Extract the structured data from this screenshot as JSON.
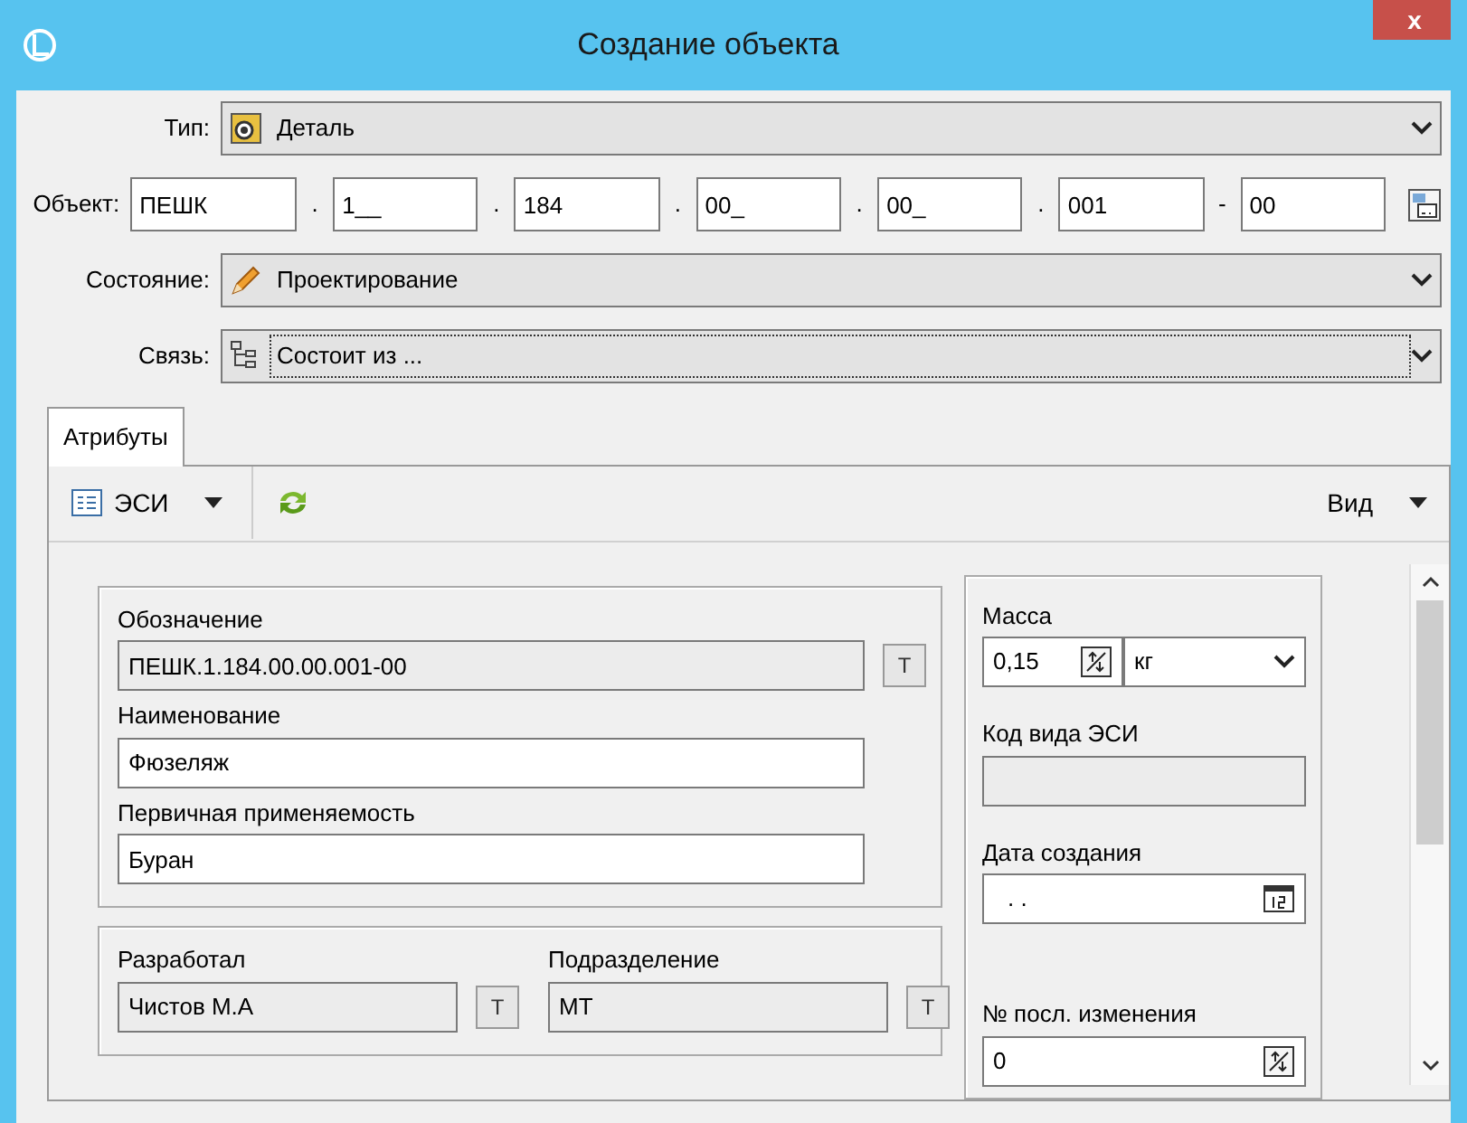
{
  "window": {
    "title": "Создание объекта",
    "close": "x"
  },
  "header_fields": [
    {
      "label": "Тип:",
      "kind": "combo",
      "value": "Деталь",
      "focused": false
    },
    {
      "label": "Объект:",
      "kind": "segments",
      "segments": [
        {
          "value": "ПЕШК"
        },
        {
          "separator": ".",
          "value": "1__"
        },
        {
          "separator": ".",
          "value": "184"
        },
        {
          "separator": ".",
          "value": "00_"
        },
        {
          "separator": ".",
          "value": "00_"
        },
        {
          "separator": ".",
          "value": "001"
        },
        {
          "separator": "-",
          "value": "00"
        }
      ]
    },
    {
      "label": "Состояние:",
      "kind": "combo",
      "value": "Проектирование",
      "focused": false
    },
    {
      "label": "Связь:",
      "kind": "combo",
      "value": "Состоит из ...",
      "focused": true
    }
  ],
  "tabs": [
    {
      "label": "Атрибуты",
      "selected": true
    }
  ],
  "toolbar": {
    "view_menu": "ЭСИ",
    "right_menu": "Вид"
  },
  "left_groups": [
    {
      "rows": [
        [
          {
            "label": "Обозначение",
            "value": "ПЕШК.1.184.00.00.001-00",
            "readonly": true,
            "button": "T"
          }
        ],
        [
          {
            "label": "Наименование",
            "value": "Фюзеляж",
            "readonly": false
          }
        ],
        [
          {
            "label": "Первичная применяемость",
            "value": "Буран",
            "readonly": false
          }
        ]
      ]
    },
    {
      "rows": [
        [
          {
            "label": "Разработал",
            "value": "Чистов М.А",
            "readonly": true,
            "button": "T"
          },
          {
            "label": "Подразделение",
            "value": "МТ",
            "readonly": true,
            "button": "T"
          }
        ]
      ]
    }
  ],
  "right_fields": [
    {
      "label": "Масса",
      "kind": "mass",
      "value": "0,15",
      "unit": "кг",
      "readonly": false
    },
    {
      "label": "Код вида ЭСИ",
      "kind": "text",
      "readonly": true
    },
    {
      "label": "Дата создания",
      "kind": "date",
      "value": ". .",
      "readonly": false
    },
    {
      "label": "№ посл. изменения",
      "kind": "spin",
      "value": "0",
      "readonly": false
    }
  ]
}
